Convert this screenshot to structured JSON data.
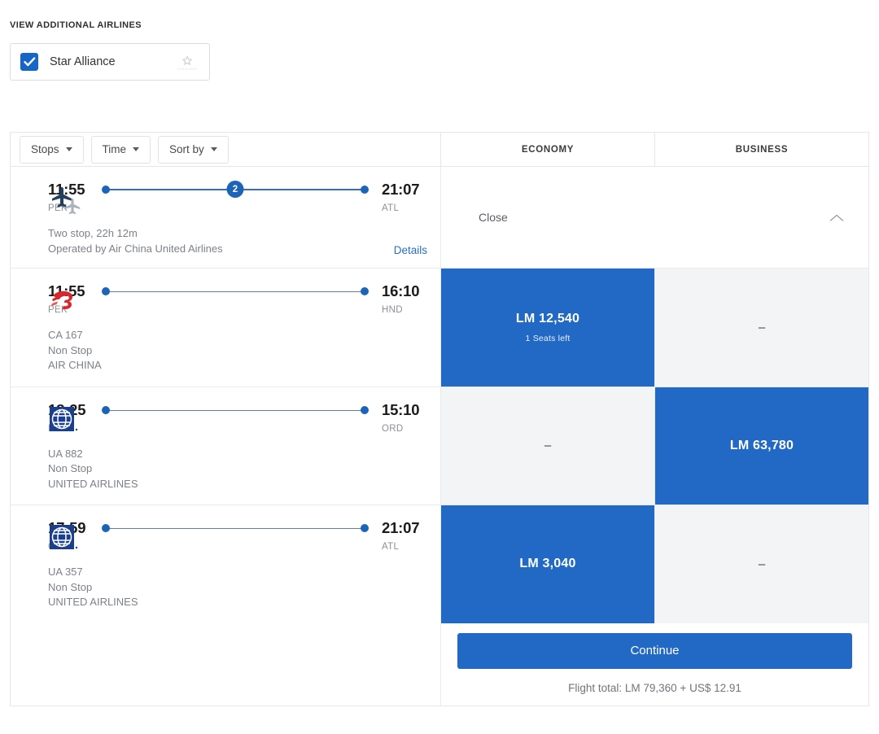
{
  "additional_airlines": {
    "title": "VIEW ADDITIONAL AIRLINES",
    "options": [
      {
        "label": "Star Alliance",
        "checked": true,
        "logo": "star-alliance-logo"
      }
    ]
  },
  "filters": [
    {
      "label": "Stops",
      "icon": "chevron-down-icon"
    },
    {
      "label": "Time",
      "icon": "chevron-down-icon"
    },
    {
      "label": "Sort by",
      "icon": "chevron-down-icon"
    }
  ],
  "columns": [
    {
      "label": "ECONOMY",
      "key": "economy"
    },
    {
      "label": "BUSINESS",
      "key": "business"
    }
  ],
  "itinerary_summary": {
    "logo": "two-planes-icon",
    "depart_time": "11:55",
    "depart_airport": "PEK",
    "arrive_time": "21:07",
    "arrive_airport": "ATL",
    "stops_badge": "2",
    "stops_text": "Two stop, 22h 12m",
    "operated_by": "Operated by Air China United Airlines",
    "details_label": "Details",
    "close_label": "Close",
    "collapse_icon": "chevron-up-icon"
  },
  "segments": [
    {
      "logo": "air-china-logo",
      "depart_time": "11:55",
      "depart_airport": "PEK",
      "arrive_time": "16:10",
      "arrive_airport": "HND",
      "flight_number": "CA 167",
      "stops": "Non Stop",
      "airline": "AIR CHINA",
      "economy": {
        "state": "selected",
        "price": "LM 12,540",
        "seats_left": "1 Seats left"
      },
      "business": {
        "state": "unavailable",
        "price": "–"
      }
    },
    {
      "logo": "united-airlines-logo",
      "depart_time": "18:25",
      "depart_airport": "HND",
      "arrive_time": "15:10",
      "arrive_airport": "ORD",
      "flight_number": "UA 882",
      "stops": "Non Stop",
      "airline": "UNITED AIRLINES",
      "economy": {
        "state": "unavailable",
        "price": "–"
      },
      "business": {
        "state": "selected",
        "price": "LM 63,780"
      }
    },
    {
      "logo": "united-airlines-logo",
      "depart_time": "17:59",
      "depart_airport": "ORD",
      "arrive_time": "21:07",
      "arrive_airport": "ATL",
      "flight_number": "UA 357",
      "stops": "Non Stop",
      "airline": "UNITED AIRLINES",
      "economy": {
        "state": "selected",
        "price": "LM 3,040"
      },
      "business": {
        "state": "unavailable",
        "price": "–"
      }
    }
  ],
  "footer": {
    "continue_label": "Continue",
    "flight_total": "Flight total: LM 79,360 + US$ 12.91"
  },
  "colors": {
    "accent_blue": "#2269c6",
    "selected_cell": "#2269c6",
    "empty_cell": "#f3f4f6",
    "link_blue": "#2b6fc4",
    "air_china_red": "#d6282c",
    "united_blue": "#1b3f8f",
    "border": "#e4e7ea"
  }
}
